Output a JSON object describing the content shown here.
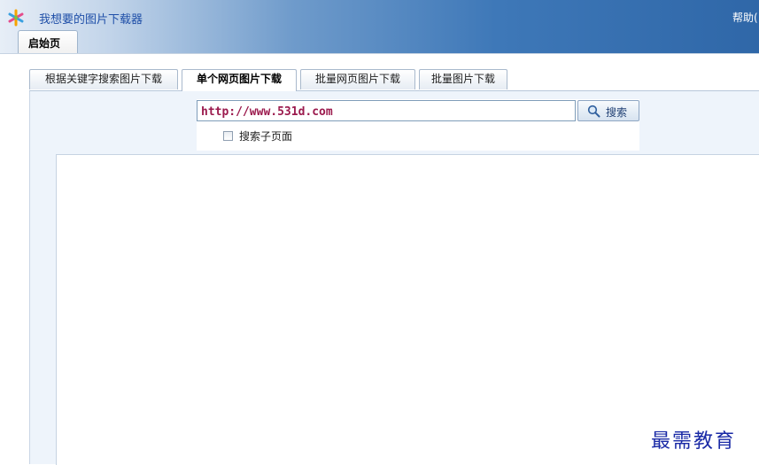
{
  "app": {
    "title": "我想要的图片下载器",
    "help_label": "帮助("
  },
  "start_tab": {
    "label": "启始页"
  },
  "tabs": [
    {
      "label": "根据关键字搜索图片下载",
      "active": false
    },
    {
      "label": "单个网页图片下载",
      "active": true
    },
    {
      "label": "批量网页图片下载",
      "active": false
    },
    {
      "label": "批量图片下载",
      "active": false
    }
  ],
  "search": {
    "url_value": "http://www.531d.com",
    "button_label": "搜索",
    "subpage_label": "搜索子页面",
    "subpage_checked": false
  },
  "watermark": "最需教育",
  "colors": {
    "title_text": "#1f4fa8",
    "url_text": "#9b1a4d",
    "watermark": "#1a2aa6",
    "panel_bg": "#eef4fb"
  },
  "icons": {
    "logo": "star-logo-icon",
    "search": "magnifier-icon"
  }
}
